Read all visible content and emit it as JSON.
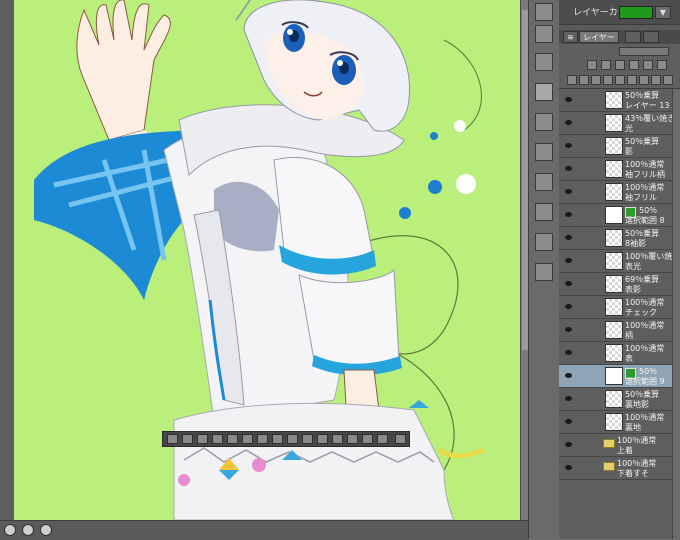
{
  "panel": {
    "layer_color_label": "レイヤーカラー",
    "layer_color_value": "#1f9a1f",
    "tab_layer": "レイヤー"
  },
  "layers": [
    {
      "t1": "50％乗算",
      "t2": "レイヤー 13",
      "type": "raster",
      "visible": true
    },
    {
      "t1": "43％覆い焼き",
      "t2": "光",
      "type": "raster",
      "visible": true
    },
    {
      "t1": "50％乗算",
      "t2": "影",
      "type": "raster",
      "visible": true
    },
    {
      "t1": "100％通常",
      "t2": "袖フリル柄",
      "type": "raster",
      "visible": true
    },
    {
      "t1": "100％通常",
      "t2": "袖フリル",
      "type": "raster",
      "visible": true
    },
    {
      "t1": "50％",
      "t2": "選択範囲 8",
      "type": "mask",
      "visible": true
    },
    {
      "t1": "50％乗算",
      "t2": "8袖影",
      "type": "raster",
      "visible": true
    },
    {
      "t1": "100％覆い焼き",
      "t2": "表光",
      "type": "raster",
      "visible": true
    },
    {
      "t1": "69％乗算",
      "t2": "表影",
      "type": "raster",
      "visible": true
    },
    {
      "t1": "100％通常",
      "t2": "チェック",
      "type": "raster",
      "visible": true
    },
    {
      "t1": "100％通常",
      "t2": "柄",
      "type": "raster",
      "visible": true
    },
    {
      "t1": "100％通常",
      "t2": "表",
      "type": "raster",
      "visible": true
    },
    {
      "t1": "50％",
      "t2": "選択範囲 9",
      "type": "mask",
      "visible": true,
      "selected": true
    },
    {
      "t1": "50％乗算",
      "t2": "裏地影",
      "type": "raster",
      "visible": true
    },
    {
      "t1": "100％通常",
      "t2": "裏地",
      "type": "raster",
      "visible": true
    },
    {
      "t1": "100％通常",
      "t2": "上着",
      "type": "folder",
      "visible": true
    },
    {
      "t1": "100％通常",
      "t2": "下着すそ",
      "type": "folder",
      "visible": true
    }
  ],
  "icons": {
    "eye": "eye-icon",
    "folder": "folder-icon",
    "mask": "mask-icon"
  }
}
